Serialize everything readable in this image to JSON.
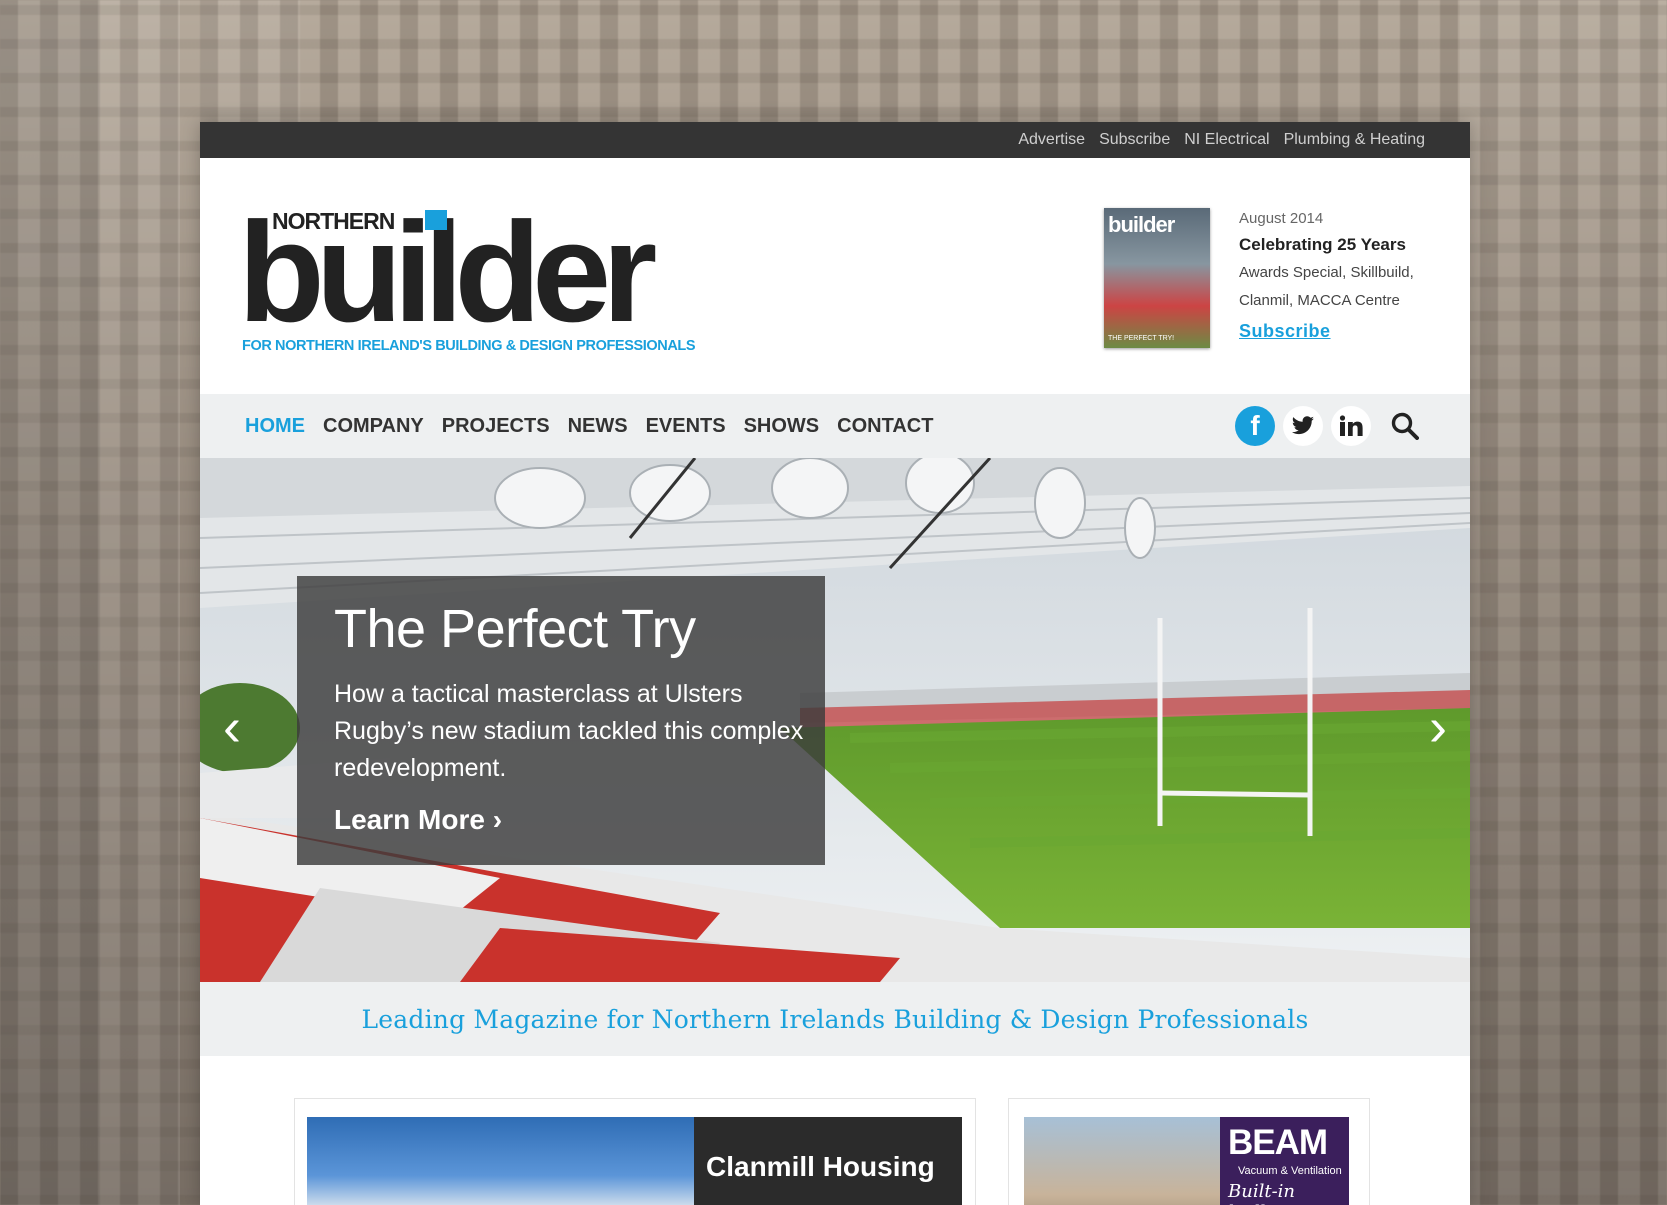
{
  "utility_links": [
    "Advertise",
    "Subscribe",
    "NI Electrical",
    "Plumbing & Heating"
  ],
  "logo": {
    "northern": "NORTHERN",
    "builder": "builder",
    "tagline": "FOR NORTHERN IRELAND'S BUILDING & DESIGN PROFESSIONALS"
  },
  "issue": {
    "cover_title": "builder",
    "cover_line": "THE PERFECT TRY!",
    "date": "August 2014",
    "headline": "Celebrating 25 Years",
    "description": "Awards Special, Skillbuild, Clanmil, MACCA Centre",
    "subscribe": "Subscribe"
  },
  "nav": {
    "items": [
      "HOME",
      "COMPANY",
      "PROJECTS",
      "NEWS",
      "EVENTS",
      "SHOWS",
      "CONTACT"
    ],
    "active": "HOME"
  },
  "social": [
    "facebook-icon",
    "twitter-icon",
    "linkedin-icon",
    "search-icon"
  ],
  "hero": {
    "title": "The Perfect Try",
    "description": "How a tactical masterclass at Ulsters Rugby’s new stadium tackled this complex redevelopment.",
    "cta": "Learn More ›",
    "prev": "‹",
    "next": "›"
  },
  "lead": "Leading Magazine for Northern Irelands Building & Design Professionals",
  "cards": {
    "card1_title": "Clanmill Housing",
    "card2_brand": "BEAM",
    "card2_sub": "Vacuum & Ventilation",
    "card2_slogan": "Built-in brilliance!"
  },
  "colors": {
    "accent": "#19a0dc",
    "topbar": "#343434",
    "navbar": "#eef0f1"
  }
}
